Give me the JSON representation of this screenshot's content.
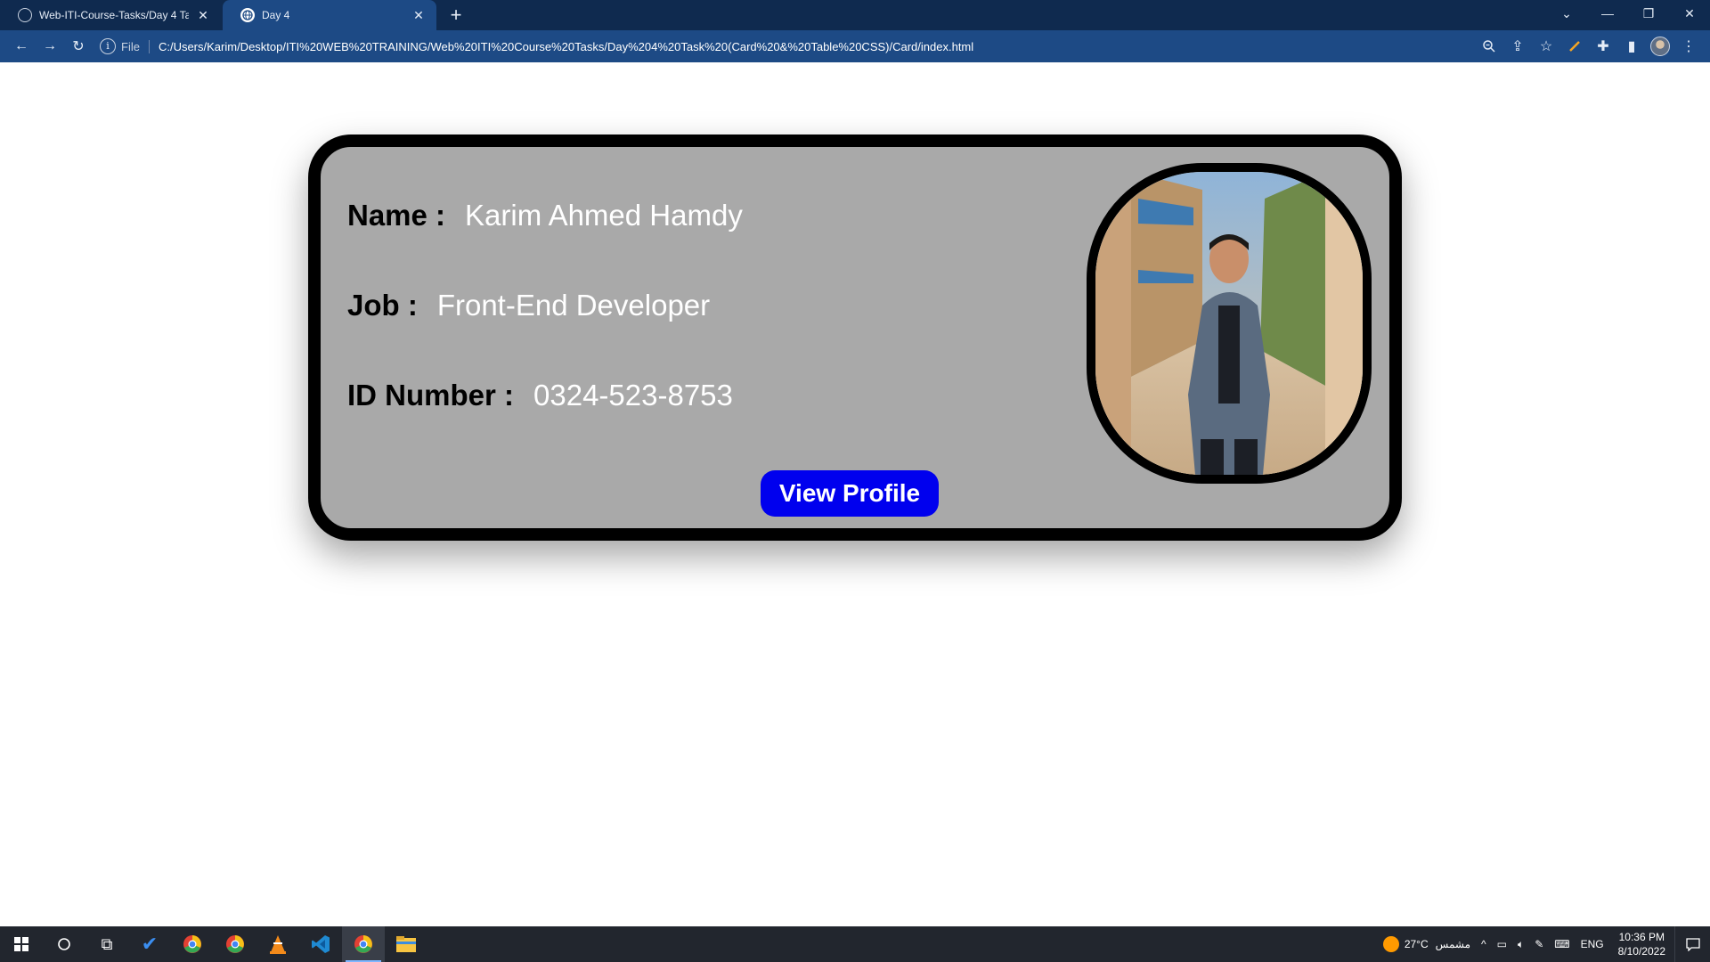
{
  "browser": {
    "tabs": [
      {
        "title": "Web-ITI-Course-Tasks/Day 4 Tasl",
        "active": false
      },
      {
        "title": "Day 4",
        "active": true
      }
    ],
    "address": {
      "scheme_label": "File",
      "url": "C:/Users/Karim/Desktop/ITI%20WEB%20TRAINING/Web%20ITI%20Course%20Tasks/Day%204%20Task%20(Card%20&%20Table%20CSS)/Card/index.html"
    }
  },
  "card": {
    "name_label": "Name :",
    "name_value": "Karim Ahmed Hamdy",
    "job_label": "Job :",
    "job_value": "Front-End Developer",
    "id_label": "ID Number :",
    "id_value": "0324-523-8753",
    "button_label": "View Profile",
    "button_color": "#0000ee",
    "card_background": "#a9a9a9"
  },
  "taskbar": {
    "weather_temp": "27°C",
    "weather_text": "مشمس",
    "language": "ENG",
    "time": "10:36 PM",
    "date": "8/10/2022"
  }
}
